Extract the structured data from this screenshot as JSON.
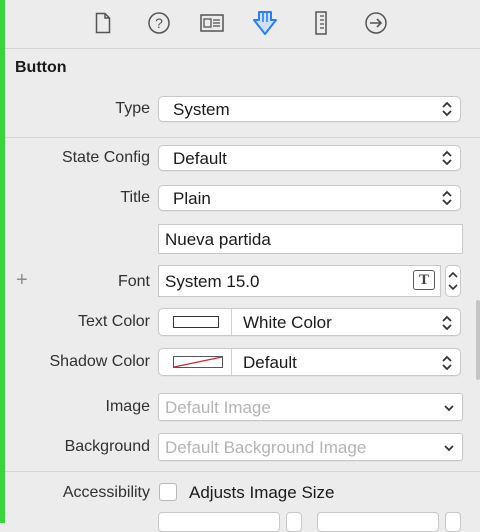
{
  "toolbar": {
    "icons": [
      "file-inspector-icon",
      "quick-help-icon",
      "identity-inspector-icon",
      "attributes-inspector-icon",
      "size-inspector-icon",
      "connections-inspector-icon"
    ]
  },
  "section": {
    "title": "Button"
  },
  "type": {
    "label": "Type",
    "value": "System"
  },
  "state_config": {
    "label": "State Config",
    "value": "Default"
  },
  "title": {
    "label": "Title",
    "value": "Plain",
    "text_value": "Nueva partida"
  },
  "font": {
    "add_symbol": "+",
    "label": "Font",
    "value": "System 15.0"
  },
  "text_color": {
    "label": "Text Color",
    "value": "White Color"
  },
  "shadow_color": {
    "label": "Shadow Color",
    "value": "Default"
  },
  "image": {
    "label": "Image",
    "placeholder": "Default Image"
  },
  "background": {
    "label": "Background",
    "placeholder": "Default Background Image"
  },
  "accessibility": {
    "label": "Accessibility",
    "checkbox_label": "Adjusts Image Size",
    "checked": false
  },
  "colors": {
    "accent_blue": "#2a7ff6",
    "sidebar_green": "#3cd43c"
  }
}
